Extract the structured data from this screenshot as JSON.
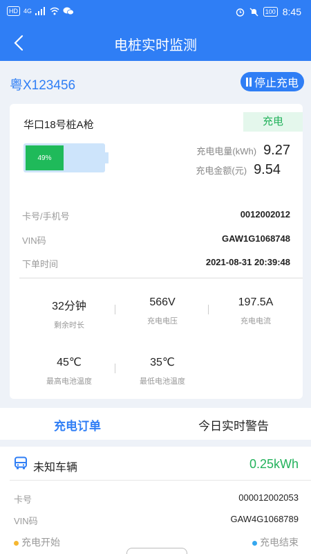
{
  "status_bar": {
    "left_badges": [
      "HD",
      "4G"
    ],
    "battery": "100",
    "time": "8:45"
  },
  "header": {
    "title": "电桩实时监测"
  },
  "vehicle": {
    "plate": "粤X123456",
    "stop_button": "停止充电"
  },
  "charger": {
    "name": "华口18号桩A枪",
    "state": "充电",
    "battery_percent": 49,
    "battery_label": "49%",
    "energy_label": "充电电量(kWh)",
    "energy_value": "9.27",
    "amount_label": "充电金额(元)",
    "amount_value": "9.54",
    "info": [
      {
        "label": "卡号/手机号",
        "value": "0012002012"
      },
      {
        "label": "VIN码",
        "value": "GAW1G1068748"
      },
      {
        "label": "下单时间",
        "value": "2021-08-31 20:39:48"
      }
    ],
    "metrics": [
      {
        "value": "32分钟",
        "label": "剩余时长"
      },
      {
        "value": "566V",
        "label": "充电电压"
      },
      {
        "value": "197.5A",
        "label": "充电电流"
      },
      {
        "value": "45℃",
        "label": "最高电池温度"
      },
      {
        "value": "35℃",
        "label": "最低电池温度"
      }
    ]
  },
  "tabs": [
    {
      "label": "充电订单",
      "active": true
    },
    {
      "label": "今日实时警告",
      "active": false
    }
  ],
  "order": {
    "vehicle": "未知车辆",
    "energy": "0.25kWh",
    "card_label": "卡号",
    "card_value": "000012002053",
    "vin_label": "VIN码",
    "vin_value": "GAW4G1068789",
    "start_label": "充电开始",
    "end_label": "充电结束"
  },
  "colors": {
    "primary": "#2f7ef5",
    "success": "#22b25b",
    "start_dot": "#f5b731",
    "end_dot": "#35a7ef"
  }
}
